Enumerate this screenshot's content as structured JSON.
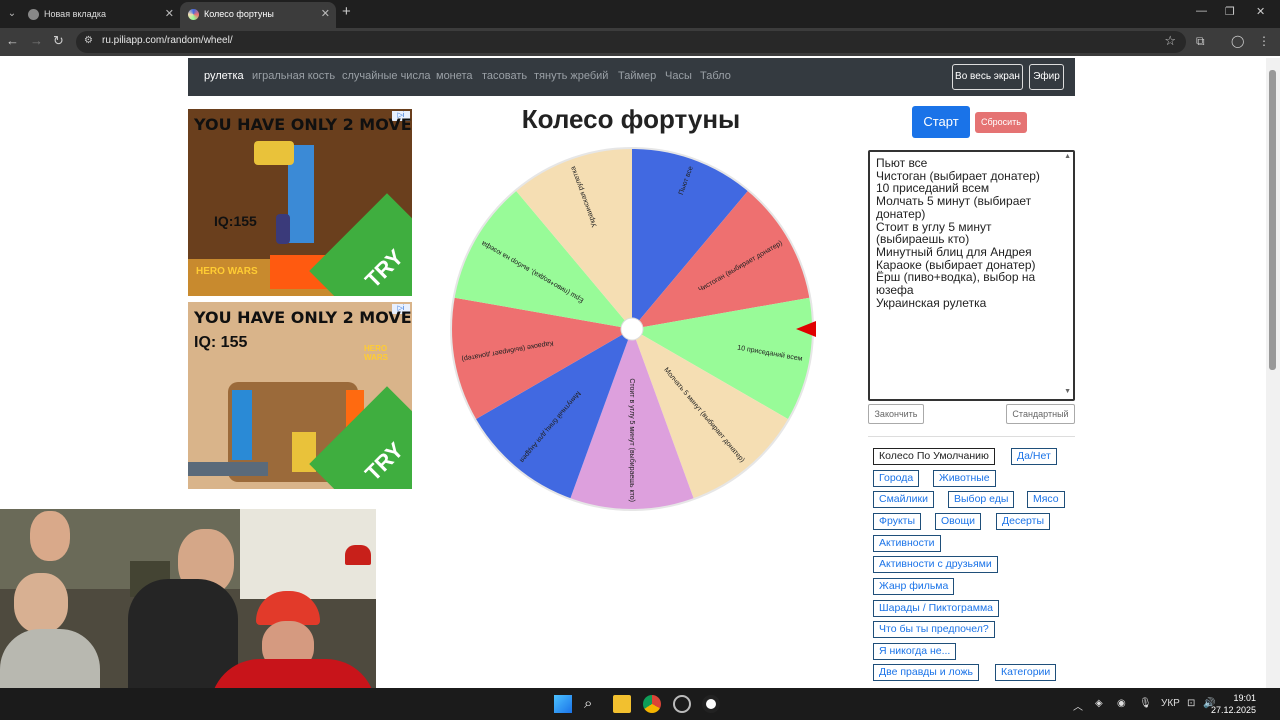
{
  "browser": {
    "tabs": [
      {
        "title": "Новая вкладка",
        "active": false
      },
      {
        "title": "Колесо фортуны",
        "active": true
      }
    ],
    "url": "ru.piliapp.com/random/wheel/"
  },
  "site_nav": {
    "items": [
      "рулетка",
      "игральная кость",
      "случайные числа",
      "монета",
      "тасовать",
      "тянуть жребий",
      "Таймер",
      "Часы",
      "Табло"
    ],
    "fullscreen_label": "Во весь экран",
    "broadcast_label": "Эфир"
  },
  "ads": [
    {
      "headline": "YOU HAVE ONLY 2 MOVES",
      "iq": "IQ:155",
      "cta": "TRY",
      "brand": "HERO WARS"
    },
    {
      "headline": "YOU HAVE ONLY 2 MOVES",
      "iq": "IQ: 155",
      "cta": "TRY",
      "brand": "HERO WARS"
    }
  ],
  "wheel": {
    "title": "Колесо фортуны",
    "segments": [
      {
        "label": "Пьют все",
        "color": "#4169e1"
      },
      {
        "label": "Чистоган (выбирает донатер)",
        "color": "#ee7070"
      },
      {
        "label": "10 приседаний всем",
        "color": "#98fb98"
      },
      {
        "label": "Молчать 5 минут (выбирает донатер)",
        "color": "#f5deb3"
      },
      {
        "label": "Стоит в углу 5 минут (выбираешь кто)",
        "color": "#dda0dd"
      },
      {
        "label": "Минутный блиц для Андрея",
        "color": "#4169e1"
      },
      {
        "label": "Караоке (выбирает донатер)",
        "color": "#ee7070"
      },
      {
        "label": "Ёрш (пиво+водка), выбор на юзефа",
        "color": "#98fb98"
      },
      {
        "label": "Украинская рулетка",
        "color": "#f5deb3"
      }
    ],
    "pointer_color": "#e00000"
  },
  "controls": {
    "start_label": "Старт",
    "reset_label": "Сбросить",
    "entries_text_lines": [
      "Пьют все",
      "Чистоган (выбирает донатер)",
      "10 приседаний всем",
      "Молчать 5 минут (выбирает",
      "донатер)",
      "Стоит в углу 5 минут",
      "(выбираешь кто)",
      "Минутный блиц для Андрея",
      "Караоке (выбирает донатер)",
      "Ёрш (пиво+водка), выбор на",
      "юзефа",
      "Украинская рулетка"
    ],
    "finish_label": "Закончить",
    "standard_label": "Стандартный"
  },
  "presets": [
    "Колесо По Умолчанию",
    "Да/Нет",
    "Города",
    "Животные",
    "Смайлики",
    "Выбор еды",
    "Мясо",
    "Фрукты",
    "Овощи",
    "Десерты",
    "Активности",
    "Активности с друзьями",
    "Жанр фильма",
    "Шарады / Пиктограмма",
    "Что бы ты предпочел?",
    "Я никогда не...",
    "Две правды и ложь",
    "Категории"
  ],
  "taskbar": {
    "language": "УКР",
    "time": "19:01",
    "date": "27.12.2025"
  }
}
